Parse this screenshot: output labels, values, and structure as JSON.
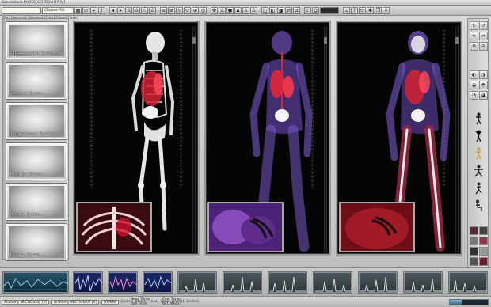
{
  "app": {
    "title": "Simulations PHOTO SECTION 07 [V]",
    "file_field": "Choose File"
  },
  "menu": [
    "[File]",
    "[Settings]",
    "[Window]",
    "[Data]",
    "[View]",
    "[Tools]"
  ],
  "sidebar": {
    "items": [
      {
        "label": "Cardiovascular System...",
        "icon": "heart-thumb"
      },
      {
        "label": "Skeletal System...",
        "icon": "pelvis-thumb"
      },
      {
        "label": "Integumentary System...",
        "icon": "foot-thumb"
      },
      {
        "label": "Muscular System...",
        "icon": "torso-thumb"
      },
      {
        "label": "Nervous System...",
        "icon": "spine-thumb"
      },
      {
        "label": "Osseous Tissue...",
        "icon": "bone-thumb"
      }
    ]
  },
  "viewports": [
    {
      "name": "skeletal-view",
      "mode": "skeleton",
      "accent": "#e8e8e8"
    },
    {
      "name": "translucent-view",
      "mode": "translucent",
      "accent": "#7b5fc4"
    },
    {
      "name": "combined-view",
      "mode": "combined",
      "accent": "#9c3a5a"
    }
  ],
  "statusbar": {
    "fields": [
      "Anatomy SECTION 02 [V]",
      "Anatomy SECTION 07 [V]",
      "[OPEN]"
    ],
    "tags": [
      "[Index]",
      "[Index]",
      "[nex]",
      "[nex]",
      "[Index]",
      "[Index]"
    ],
    "head_temp_label": "Head Temp:",
    "run_time_label": "Run Time:",
    "cool_timer_label": "Cool Timer:",
    "nfl_steps_label": "NFL Steps:",
    "progress": 0.32
  },
  "colors": {
    "organ_red": "#e0263a",
    "skeleton": "#e6e6e6",
    "translucent": "#7c5cc8",
    "monitor_blue": "#1d2b6a",
    "chrome": "#c9cbc9"
  }
}
